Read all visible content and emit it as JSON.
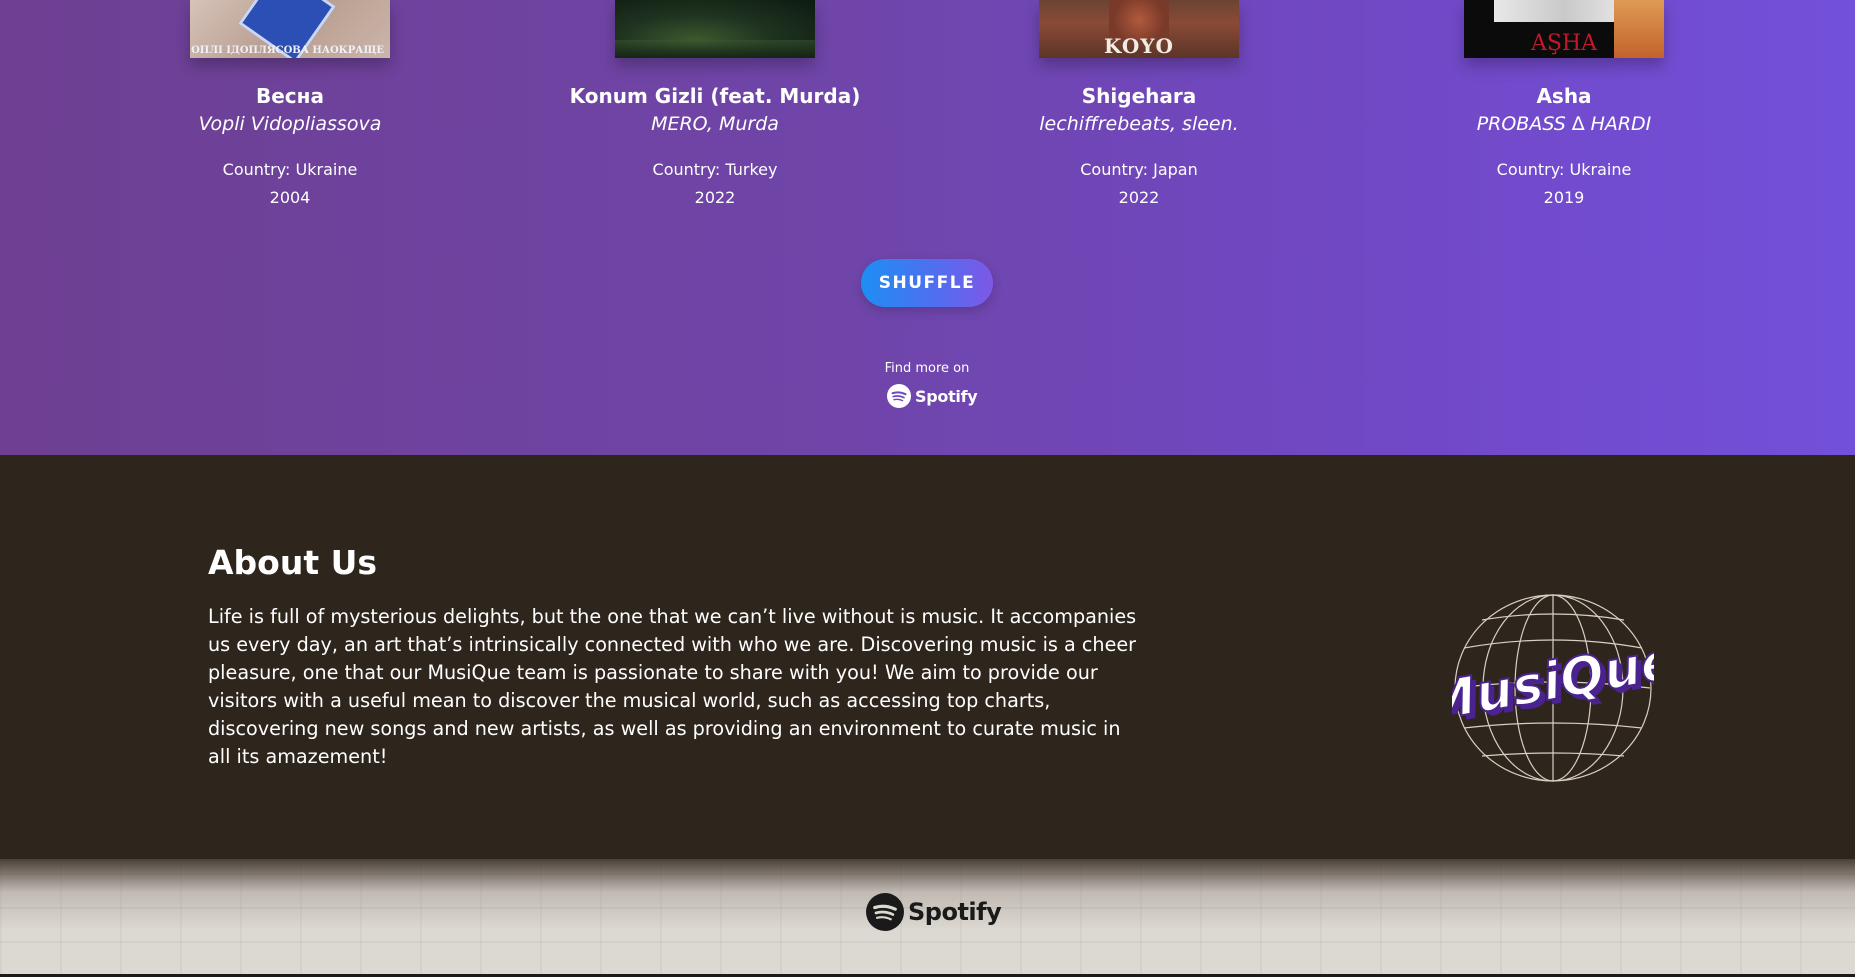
{
  "songs": [
    {
      "title": "Весна",
      "artist": "Vopli Vidopliassova",
      "country": "Country: Ukraine",
      "year": "2004",
      "cover_text": "ОПЛІ ІДОПЛЯСОВА НАОКРАЩЕ"
    },
    {
      "title": "Konum Gizli (feat. Murda)",
      "artist": "MERO, Murda",
      "country": "Country: Turkey",
      "year": "2022",
      "cover_text": ""
    },
    {
      "title": "Shigehara",
      "artist": "lechiffrebeats, sleen.",
      "country": "Country: Japan",
      "year": "2022",
      "cover_text": "KOYO"
    },
    {
      "title": "Asha",
      "artist": "PROBASS ∆ HARDI",
      "country": "Country: Ukraine",
      "year": "2019",
      "cover_text": "AŞHA"
    }
  ],
  "shuffle_label": "SHUFFLE",
  "find_more": {
    "text": "Find more on",
    "brand": "Spotify"
  },
  "about": {
    "title": "About Us",
    "body": "Life is full of mysterious delights, but the one that we can’t live without is music. It accompanies us every day, an art that’s intrinsically connected with who we are. Discovering music is a cheer pleasure, one that our MusiQue team is passionate to share with you! We aim to provide our visitors with a useful mean to discover the musical world, such as accessing top charts, discovering new songs and new artists, as well as providing an environment to curate music in all its amazement!"
  },
  "logo": {
    "text": "MusiQue",
    "icon": "globe-icon"
  },
  "footer": {
    "brand": "Spotify",
    "icon": "spotify-icon"
  },
  "colors": {
    "purple_start": "#6e3f92",
    "purple_end": "#7350da",
    "about_bg": "#2e251d",
    "shuffle_start": "#1d8ef4",
    "shuffle_end": "#7d58e6",
    "logo_purple": "#4a2390"
  }
}
